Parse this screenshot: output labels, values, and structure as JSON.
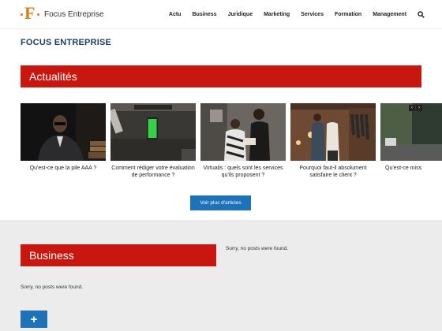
{
  "header": {
    "logo_text": "Focus Entreprise",
    "logo_letter": "F",
    "nav": [
      "Actu",
      "Business",
      "Juridique",
      "Marketing",
      "Services",
      "Formation",
      "Management"
    ]
  },
  "site_title": "FOCUS ENTREPRISE",
  "actualites": {
    "heading": "Actualités",
    "articles": [
      {
        "caption": "Qu'est-ce que la pile AAA ?"
      },
      {
        "caption": "Comment rédiger votre évaluation de performance ?"
      },
      {
        "caption": "Virtualis : quels sont les services qu'ils proposent ?"
      },
      {
        "caption": "Pourquoi faut-il absolument satisfaire le client ?"
      },
      {
        "caption": "Qu'est-ce miss"
      }
    ],
    "more_label": "Voir plus d'articles",
    "prev_arrow": "‹",
    "next_arrow": "›"
  },
  "business": {
    "heading": "Business",
    "empty_text": "Sorry, no posts were found.",
    "plus_label": "+"
  },
  "side": {
    "empty_text": "Sorry, no posts were found."
  },
  "colors": {
    "accent_red": "#c8170e",
    "button_blue": "#1e73b8",
    "title_blue": "#1f3d63",
    "logo_orange": "#e07a1f",
    "lower_bg": "#ececec"
  }
}
